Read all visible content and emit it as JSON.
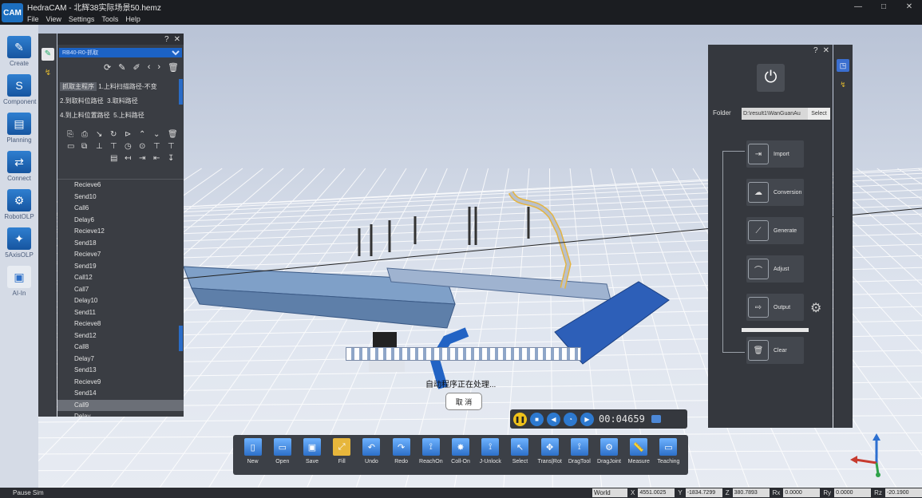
{
  "window": {
    "title": "HedraCAM - 北辉38实际场景50.hemz",
    "logo": "CAM"
  },
  "menu": [
    "File",
    "View",
    "Settings",
    "Tools",
    "Help"
  ],
  "modules": [
    {
      "label": "Create",
      "icon": "create-icon"
    },
    {
      "label": "Component",
      "icon": "component-icon"
    },
    {
      "label": "Planning",
      "icon": "planning-icon"
    },
    {
      "label": "Connect",
      "icon": "connect-icon"
    },
    {
      "label": "RobotOLP",
      "icon": "robot-olp-icon"
    },
    {
      "label": "5AxisOLP",
      "icon": "five-axis-icon"
    },
    {
      "label": "AI-In",
      "icon": "ai-in-icon"
    }
  ],
  "left_panel": {
    "program_select": "RB40-R0-抓取",
    "program_tabs": [
      "抓取主程序",
      "1.上料扫描路径-不变",
      "2.到取料位路径",
      "3.取料路径",
      "4.到上料位置路径",
      "5.上料路径"
    ],
    "commands": [
      "Recieve6",
      "Send10",
      "Call6",
      "Delay6",
      "Recieve12",
      "Send18",
      "Recieve7",
      "Send19",
      "Call12",
      "Call7",
      "Delay10",
      "Send11",
      "Recieve8",
      "Send12",
      "Call8",
      "Delay7",
      "Send13",
      "Recieve9",
      "Send14",
      "Call9",
      "Delay"
    ],
    "selected_command": "Call9"
  },
  "right_panel": {
    "folder_label": "Folder",
    "folder_value": "D:\\result1\\WanGuanAu",
    "select_label": "Select",
    "steps": [
      "Import",
      "Conversion",
      "Generate",
      "Adjust",
      "Output",
      "Clear"
    ]
  },
  "processing": {
    "text": "自动程序正在处理...",
    "cancel_label": "取 消"
  },
  "playback": {
    "timer": "00:04659"
  },
  "toolbar": [
    "New",
    "Open",
    "Save",
    "Fill",
    "Undo",
    "Redo",
    "ReachOn",
    "Coll-On",
    "J-Unlock",
    "Select",
    "Trans|Rot",
    "DragTool",
    "DragJoint",
    "Measure",
    "Teaching"
  ],
  "status": {
    "sim": "Pause Sim",
    "frame": "World",
    "x_label": "X",
    "x": "4551.0025",
    "y_label": "Y",
    "y": "-1834.7299",
    "z_label": "Z",
    "z": "380.7893",
    "rx_label": "Rx",
    "rx": "0.0000",
    "ry_label": "Ry",
    "ry": "0.0000",
    "rz_label": "Rz",
    "rz": "-20.1900"
  }
}
